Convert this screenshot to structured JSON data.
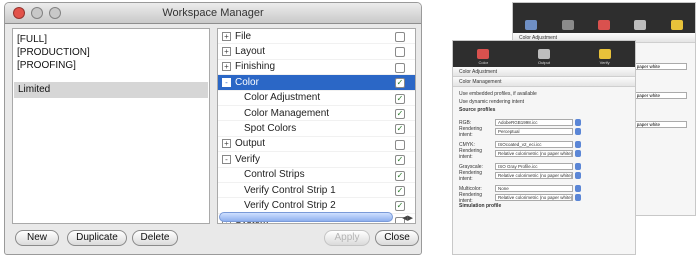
{
  "window": {
    "title": "Workspace Manager"
  },
  "profiles": {
    "top": [
      "[FULL]",
      "[PRODUCTION]",
      "[PROOFING]"
    ],
    "selected": "Limited"
  },
  "tree": [
    {
      "label": "File",
      "level": 0,
      "expander": "+",
      "checked": false,
      "selected": false
    },
    {
      "label": "Layout",
      "level": 0,
      "expander": "+",
      "checked": false,
      "selected": false
    },
    {
      "label": "Finishing",
      "level": 0,
      "expander": "+",
      "checked": false,
      "selected": false
    },
    {
      "label": "Color",
      "level": 0,
      "expander": "-",
      "checked": true,
      "selected": true
    },
    {
      "label": "Color Adjustment",
      "level": 1,
      "expander": "",
      "checked": true,
      "selected": false
    },
    {
      "label": "Color Management",
      "level": 1,
      "expander": "",
      "checked": true,
      "selected": false
    },
    {
      "label": "Spot Colors",
      "level": 1,
      "expander": "",
      "checked": true,
      "selected": false
    },
    {
      "label": "Output",
      "level": 0,
      "expander": "+",
      "checked": false,
      "selected": false
    },
    {
      "label": "Verify",
      "level": 0,
      "expander": "-",
      "checked": true,
      "selected": false
    },
    {
      "label": "Control Strips",
      "level": 1,
      "expander": "",
      "checked": true,
      "selected": false
    },
    {
      "label": "Verify Control Strip 1",
      "level": 1,
      "expander": "",
      "checked": true,
      "selected": false
    },
    {
      "label": "Verify Control Strip 2",
      "level": 1,
      "expander": "",
      "checked": true,
      "selected": false
    },
    {
      "label": "System",
      "level": 0,
      "expander": "+",
      "checked": false,
      "selected": false
    }
  ],
  "buttons": {
    "new": "New",
    "duplicate": "Duplicate",
    "delete": "Delete",
    "apply": "Apply",
    "close": "Close"
  },
  "preview_back": {
    "toolbar_icons": [
      "file",
      "layout",
      "color",
      "output",
      "finishing"
    ],
    "toolbar_icon_colors": [
      "#6f8fc4",
      "#8a8a8a",
      "#d9514e",
      "#bdbdbd",
      "#e8c23a"
    ],
    "header": "Color Adjustment",
    "fields_right": [
      "in paper white",
      "in paper white",
      "in paper white"
    ]
  },
  "preview_front": {
    "toolbar_icons": [
      "color",
      "output",
      "finishing"
    ],
    "toolbar_icon_colors": [
      "#d9514e",
      "#bdbdbd",
      "#e8c23a"
    ],
    "toolbar_labels": [
      "Color",
      "Output",
      "Verify"
    ],
    "sections": [
      "Color Adjustment",
      "Color Management"
    ],
    "checkboxes": [
      "Use embedded profiles, if available",
      "Use dynamic rendering intent"
    ],
    "source_label": "Source profiles",
    "rows": [
      {
        "k": "RGB:",
        "v": "AdobeRGB1998.icc"
      },
      {
        "k": "Rendering intent:",
        "v": "Perceptual"
      },
      {
        "k": "CMYK:",
        "v": "ISOcoated_v2_eci.icc"
      },
      {
        "k": "Rendering intent:",
        "v": "Relative colorimetric (no paper white)"
      },
      {
        "k": "Grayscale:",
        "v": "ISO Gray Profile.icc"
      },
      {
        "k": "Rendering intent:",
        "v": "Relative colorimetric (no paper white)"
      },
      {
        "k": "Multicolor:",
        "v": "None"
      },
      {
        "k": "Rendering intent:",
        "v": "Relative colorimetric (no paper white)"
      }
    ],
    "footer_label": "Simulation profile"
  }
}
